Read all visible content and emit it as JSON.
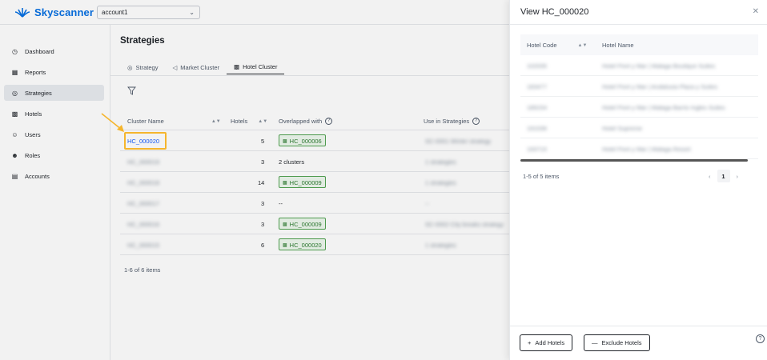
{
  "header": {
    "logo_text": "Skyscanner",
    "account": "account1"
  },
  "sidebar": {
    "items": [
      {
        "label": "Dashboard",
        "icon": "dashboard-icon"
      },
      {
        "label": "Reports",
        "icon": "reports-icon"
      },
      {
        "label": "Strategies",
        "icon": "strategies-icon",
        "active": true
      },
      {
        "label": "Hotels",
        "icon": "hotels-icon"
      },
      {
        "label": "Users",
        "icon": "users-icon"
      },
      {
        "label": "Roles",
        "icon": "roles-icon"
      },
      {
        "label": "Accounts",
        "icon": "accounts-icon"
      }
    ]
  },
  "main": {
    "title": "Strategies",
    "tabs": [
      {
        "label": "Strategy"
      },
      {
        "label": "Market Cluster"
      },
      {
        "label": "Hotel Cluster",
        "active": true
      }
    ],
    "columns": {
      "cluster_name": "Cluster Name",
      "hotels": "Hotels",
      "overlapped": "Overlapped with",
      "use_in": "Use in Strategies"
    },
    "rows": [
      {
        "name": "HC_000020",
        "hotels": "5",
        "overlap": "HC_000006",
        "overlap_type": "tag",
        "strategies": "SC-0001 Winter strategy"
      },
      {
        "name": "HC_000019",
        "hotels": "3",
        "overlap": "2 clusters",
        "overlap_type": "text",
        "strategies": "1 strategies"
      },
      {
        "name": "HC_000018",
        "hotels": "14",
        "overlap": "HC_000009",
        "overlap_type": "tag",
        "strategies": "1 strategies"
      },
      {
        "name": "HC_000017",
        "hotels": "3",
        "overlap": "--",
        "overlap_type": "text",
        "strategies": "--"
      },
      {
        "name": "HC_000016",
        "hotels": "3",
        "overlap": "HC_000009",
        "overlap_type": "tag",
        "strategies": "SC-0002 City breaks strategy"
      },
      {
        "name": "HC_000015",
        "hotels": "6",
        "overlap": "HC_000020",
        "overlap_type": "tag",
        "strategies": "1 strategies"
      }
    ],
    "count_text": "1-6 of 6 items"
  },
  "drawer": {
    "title": "View HC_000020",
    "columns": {
      "code": "Hotel Code",
      "name": "Hotel Name"
    },
    "rows": [
      {
        "code": "102035",
        "name": "Hotel Pont y Mar | Malaga Boutique Suites"
      },
      {
        "code": "183477",
        "name": "Hotel Pont y Mar | Andalusia Plaza y Suites"
      },
      {
        "code": "189154",
        "name": "Hotel Pont y Mar | Malaga Barrio Ingles Suites"
      },
      {
        "code": "191036",
        "name": "Hotel Supreme"
      },
      {
        "code": "193715",
        "name": "Hotel Pont y Mar | Malaga Resort"
      }
    ],
    "count_text": "1-5 of 5 items",
    "page": "1",
    "add_label": "Add Hotels",
    "exclude_label": "Exclude Hotels"
  }
}
